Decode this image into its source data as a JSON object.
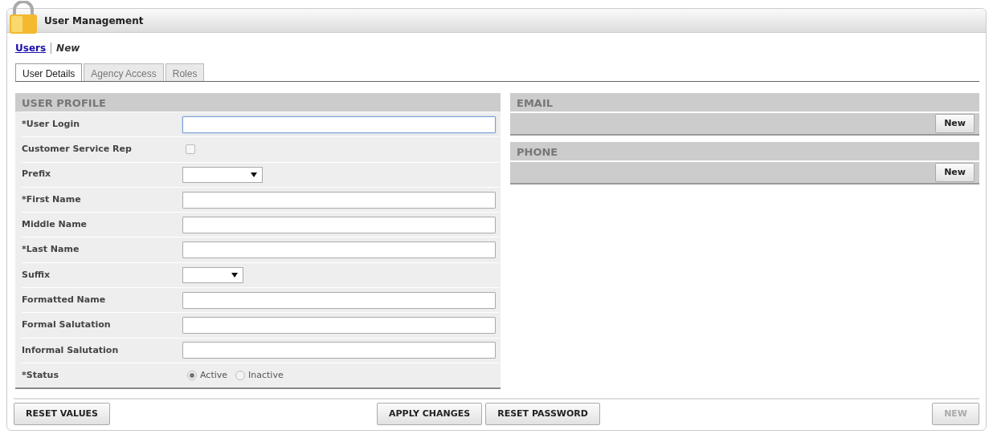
{
  "window": {
    "title": "User Management"
  },
  "breadcrumb": [
    {
      "label": "Users",
      "kind": "link"
    },
    {
      "label": "New",
      "kind": "current"
    }
  ],
  "tabs": [
    {
      "label": "User Details",
      "selected": true
    },
    {
      "label": "Agency Access",
      "selected": false
    },
    {
      "label": "Roles",
      "selected": false
    }
  ],
  "user_profile": {
    "title": "USER PROFILE",
    "fields": [
      {
        "label": "*User Login",
        "kind": "text",
        "focused": true
      },
      {
        "label": "Customer Service Rep",
        "kind": "checkbox",
        "checked": false
      },
      {
        "label": "Prefix",
        "kind": "select"
      },
      {
        "label": "*First Name",
        "kind": "text",
        "focused": false
      },
      {
        "label": "Middle Name",
        "kind": "text",
        "focused": false
      },
      {
        "label": "*Last Name",
        "kind": "text",
        "focused": false
      },
      {
        "label": "Suffix",
        "kind": "select"
      },
      {
        "label": "Formatted Name",
        "kind": "text",
        "focused": false
      },
      {
        "label": "Formal Salutation",
        "kind": "text",
        "focused": false
      },
      {
        "label": "Informal Salutation",
        "kind": "text",
        "focused": false
      },
      {
        "label": "*Status",
        "kind": "radio",
        "options": [
          {
            "label": "Active",
            "selected": true
          },
          {
            "label": "Inactive",
            "selected": false
          }
        ]
      }
    ]
  },
  "side_panels": [
    {
      "title": "EMAIL",
      "button": "New"
    },
    {
      "title": "PHONE",
      "button": "New"
    }
  ],
  "footer": {
    "left_buttons": [
      {
        "label": "RESET VALUES",
        "disabled": false
      }
    ],
    "center_buttons": [
      {
        "label": "APPLY CHANGES",
        "disabled": false
      },
      {
        "label": "RESET PASSWORD",
        "disabled": false
      }
    ],
    "right_buttons": [
      {
        "label": "NEW",
        "disabled": true
      }
    ]
  }
}
